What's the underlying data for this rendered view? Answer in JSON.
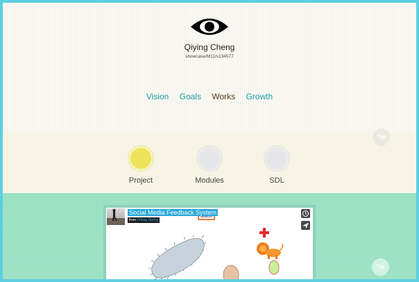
{
  "header": {
    "name": "Qiying Cheng",
    "path": "showcase/M11/s134577",
    "logo_icon": "eye-icon"
  },
  "nav": {
    "items": [
      {
        "label": "Vision"
      },
      {
        "label": "Goals"
      },
      {
        "label": "Works",
        "active": true
      },
      {
        "label": "Growth"
      }
    ],
    "link_color": "#1a9aa6",
    "active_color": "#5a3a14"
  },
  "tabs": {
    "items": [
      {
        "label": "Project",
        "active": true
      },
      {
        "label": "Modules"
      },
      {
        "label": "SDL"
      }
    ],
    "active_color": "#ece35a"
  },
  "embed": {
    "title": "Social Media Feedback System",
    "from_prefix": "from",
    "author": "Cheng Qiying",
    "canvas_label": "back",
    "controls": [
      "clock-icon",
      "send-icon"
    ]
  },
  "top_button": {
    "label": "Top"
  },
  "colors": {
    "border": "#5ccfe0",
    "header_bg": "#fbf9f3",
    "green_band": "#9be1c4"
  }
}
